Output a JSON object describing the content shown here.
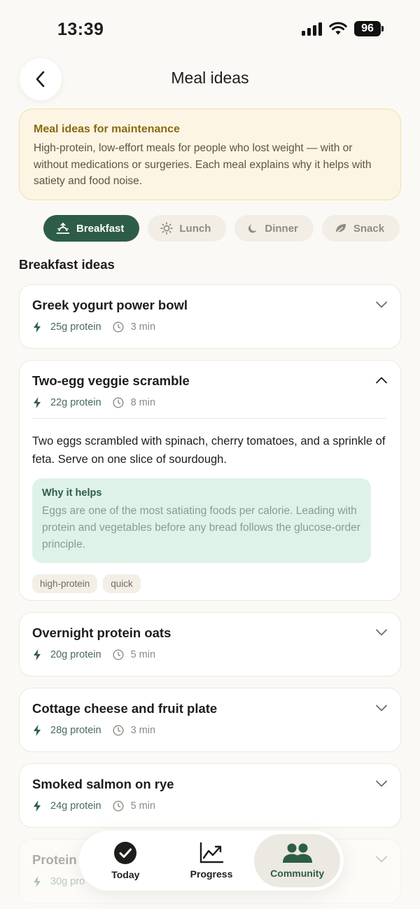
{
  "status": {
    "time": "13:39",
    "battery": "96"
  },
  "header": {
    "title": "Meal ideas",
    "back_icon": "chevron-left-icon"
  },
  "info": {
    "title": "Meal ideas for maintenance",
    "body": "High-protein, low-effort meals for people who lost weight — with or without medications or surgeries. Each meal explains why it helps with satiety and food noise."
  },
  "tabs": [
    {
      "label": "Breakfast",
      "icon": "sunrise-icon",
      "active": true
    },
    {
      "label": "Lunch",
      "icon": "sun-icon",
      "active": false
    },
    {
      "label": "Dinner",
      "icon": "moon-icon",
      "active": false
    },
    {
      "label": "Snack",
      "icon": "leaf-icon",
      "active": false
    }
  ],
  "section_title": "Breakfast ideas",
  "meals": [
    {
      "name": "Greek yogurt power bowl",
      "protein": "25g protein",
      "time": "3 min"
    },
    {
      "name": "Two-egg veggie scramble",
      "protein": "22g protein",
      "time": "8 min",
      "description": "Two eggs scrambled with spinach, cherry tomatoes, and a sprinkle of feta. Serve on one slice of sourdough.",
      "why_title": "Why it helps",
      "why_body": "Eggs are one of the most satiating foods per calorie. Leading with protein and vegetables before any bread follows the glucose-order principle.",
      "tags": [
        "high-protein",
        "quick"
      ]
    },
    {
      "name": "Overnight protein oats",
      "protein": "20g protein",
      "time": "5 min"
    },
    {
      "name": "Cottage cheese and fruit plate",
      "protein": "28g protein",
      "time": "3 min"
    },
    {
      "name": "Smoked salmon on rye",
      "protein": "24g protein",
      "time": "5 min"
    },
    {
      "name": "Protein",
      "protein": "30g pro"
    }
  ],
  "nav": [
    {
      "label": "Today",
      "icon": "check-circle-icon",
      "active": false
    },
    {
      "label": "Progress",
      "icon": "trend-chart-icon",
      "active": false
    },
    {
      "label": "Community",
      "icon": "people-icon",
      "active": true
    }
  ],
  "colors": {
    "accent": "#2e5d47",
    "info_bg": "#fdf5e3",
    "why_bg": "#dff2ea",
    "background": "#fbf9f5"
  }
}
